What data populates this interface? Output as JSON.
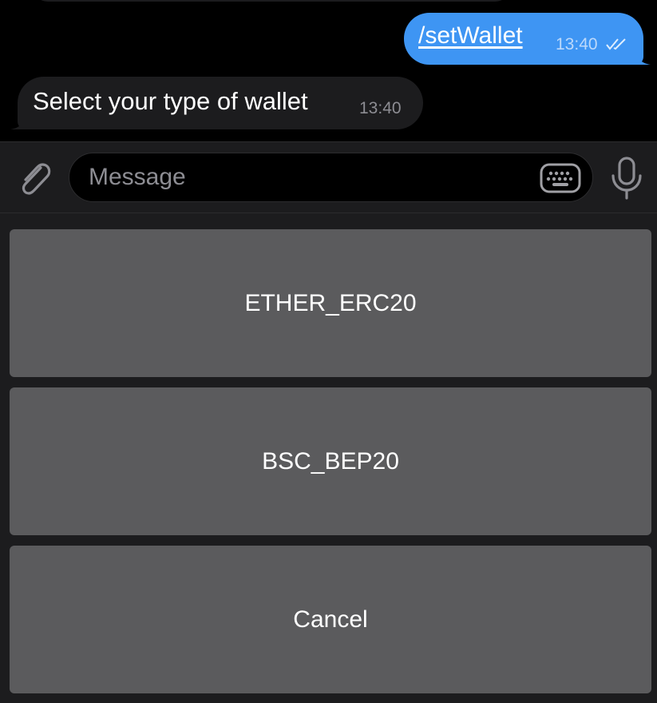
{
  "messages": {
    "outgoing": {
      "text": "/setWallet",
      "time": "13:40",
      "status": "read-double-check"
    },
    "incoming": {
      "text": "Select your type of wallet",
      "time": "13:40"
    }
  },
  "composer": {
    "placeholder": "Message",
    "attach_icon": "paperclip-icon",
    "keyboard_icon": "keyboard-icon",
    "mic_icon": "microphone-icon"
  },
  "reply_keyboard": {
    "buttons": [
      {
        "label": "ETHER_ERC20"
      },
      {
        "label": "BSC_BEP20"
      },
      {
        "label": "Cancel"
      }
    ]
  },
  "colors": {
    "background": "#000000",
    "outgoing_bubble": "#3e95f3",
    "incoming_bubble": "#1c1c1e",
    "keyboard_button": "#5b5b5d",
    "icon_gray": "#8d8d93"
  }
}
